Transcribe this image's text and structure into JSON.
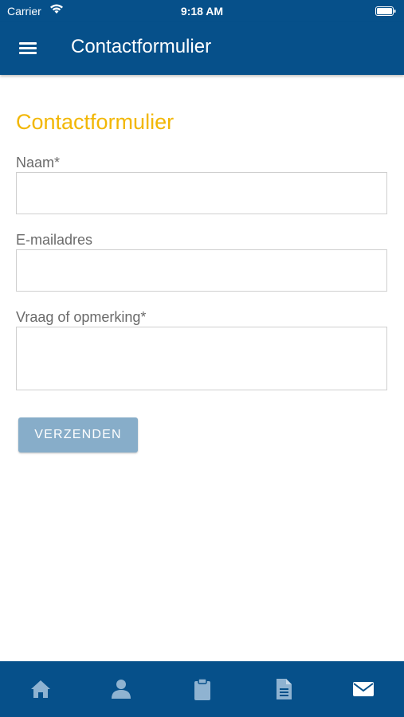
{
  "status_bar": {
    "carrier": "Carrier",
    "time": "9:18 AM"
  },
  "header": {
    "title": "Contactformulier",
    "menu_icon": "hamburger-menu-icon"
  },
  "form": {
    "heading": "Contactformulier",
    "fields": [
      {
        "label": "Naam*",
        "value": "",
        "placeholder": ""
      },
      {
        "label": "E-mailadres",
        "value": "",
        "placeholder": ""
      },
      {
        "label": "Vraag of opmerking*",
        "value": "",
        "placeholder": ""
      }
    ],
    "submit_label": "VERZENDEN"
  },
  "tab_bar": {
    "tabs": [
      {
        "icon": "home-icon"
      },
      {
        "icon": "person-icon"
      },
      {
        "icon": "clipboard-icon"
      },
      {
        "icon": "document-icon"
      },
      {
        "icon": "mail-icon",
        "active": true
      }
    ]
  },
  "colors": {
    "primary": "#06508a",
    "accent": "#f2b705",
    "button": "#87adc9",
    "label": "#6b6b6b",
    "inactive_tab_icon": "#8fb3d1",
    "active_tab_icon": "#ffffff"
  }
}
